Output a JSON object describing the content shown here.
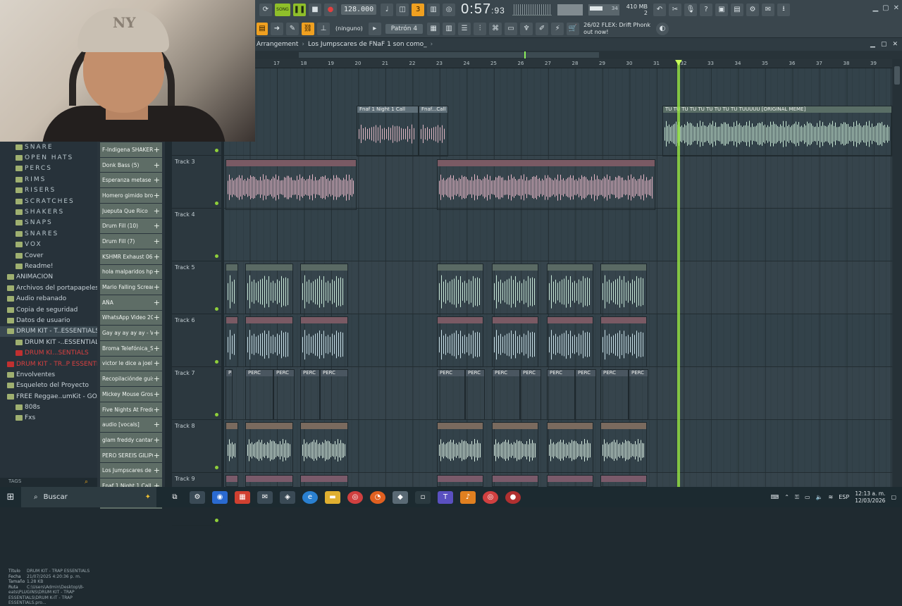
{
  "toolbar": {
    "song_label": "SONG",
    "tempo": "128.000",
    "time": "0:57",
    "time_frac": "93",
    "time_unit": "M:S:CS",
    "cpu_value": "34",
    "mem_value": "410 MB",
    "mem_poly": "2",
    "snap_value": "(ninguno)",
    "pattern": "Patrón 4",
    "hint_line1": "26/02  FLEX: Drift Phonk",
    "hint_line2": "out now!"
  },
  "arrangement": {
    "label": "Arrangement",
    "project": "Los Jumpscares de FNaF 1 son como_"
  },
  "ruler": [
    "17",
    "18",
    "19",
    "20",
    "21",
    "22",
    "23",
    "24",
    "25",
    "26",
    "27",
    "28",
    "29",
    "30",
    "31",
    "32",
    "33",
    "34",
    "35",
    "36",
    "37",
    "38",
    "39"
  ],
  "browser": {
    "items": [
      {
        "label": "SNARE",
        "style": "caps"
      },
      {
        "label": "OPEN HATS",
        "style": "caps"
      },
      {
        "label": "PERCS",
        "style": "caps"
      },
      {
        "label": "RIMS",
        "style": "caps"
      },
      {
        "label": "RISERS",
        "style": "caps"
      },
      {
        "label": "SCRATCHES",
        "style": "caps"
      },
      {
        "label": "SHAKERS",
        "style": "caps"
      },
      {
        "label": "SNAPS",
        "style": "caps"
      },
      {
        "label": "SNARES",
        "style": "caps"
      },
      {
        "label": "VOX",
        "style": "caps"
      },
      {
        "label": "Cover",
        "style": ""
      },
      {
        "label": "Readme!",
        "style": ""
      },
      {
        "label": "ANIMACION",
        "style": ""
      },
      {
        "label": "Archivos del portapapeles",
        "style": ""
      },
      {
        "label": "Audio rebanado",
        "style": ""
      },
      {
        "label": "Copia de seguridad",
        "style": ""
      },
      {
        "label": "Datos de usuario",
        "style": ""
      },
      {
        "label": "DRUM KIT - T..ESSENTIALS",
        "style": "sel"
      },
      {
        "label": "DRUM KIT -..ESSENTIALS",
        "style": ""
      },
      {
        "label": "DRUM KI...SENTIALS",
        "style": "red"
      },
      {
        "label": "DRUM KIT - TR..P ESSENTIALS",
        "style": "red"
      },
      {
        "label": "Envolventes",
        "style": ""
      },
      {
        "label": "Esqueleto del Proyecto",
        "style": ""
      },
      {
        "label": "FREE Reggae..umKit - GOAT",
        "style": ""
      },
      {
        "label": "808s",
        "style": ""
      },
      {
        "label": "Fxs",
        "style": ""
      }
    ],
    "info": {
      "titulo_k": "Título",
      "titulo_v": "DRUM KIT - TRAP ESSENTIALS",
      "fecha_k": "Fecha",
      "fecha_v": "21/07/2025 4:20:36 p. m.",
      "tamano_k": "Tamaño",
      "tamano_v": "1.28 KB",
      "ruta_k": "Ruta",
      "ruta_v": "C:\\Users\\Admin\\Desktop\\B-eats\\PLUGINS\\DRUM KIT - TRAP ESSENTIALS\\DRUM K-IT - TRAP ESSENTIALS.pro..."
    },
    "tags_label": "TAGS"
  },
  "channels": [
    "F-Indigena SHAKER_3",
    "Donk Bass (5)",
    "Esperanza metase él...",
    "Homero gimido bro...",
    "Jueputa Que Rico",
    "Drum Fill (10)",
    "Drum Fill (7)",
    "KSHMR Exhaust 06",
    "hola  malparidos  hpt",
    "Mario Falling Scream...",
    "AÑA",
    "WhatsApp Video 2025...",
    "Gay ay ay ay ay - Voi...",
    "Broma Telefónica_S...",
    "victor le dice a joel (J...",
    "Recopilaciónde guisas",
    "Mickey Mouse Groser...",
    "Five Nights At Freddy...",
    "audio [vocals]",
    "glam freddy cantand...",
    "PERO SEREIS GILIPOL...",
    "Los Jumpscares de F...",
    "Fnaf 1 Night 1 Call",
    "TU TU TU TU TU TU TU..."
  ],
  "tracks": [
    "",
    "Track 3",
    "Track 4",
    "Track 5",
    "Track 6",
    "Track 7",
    "Track 8",
    "Track 9"
  ],
  "clips": {
    "fnaf_a": "Fnaf 1 Night 1 Call",
    "fnaf_b": "Fnaf...Call",
    "tutu": "TU TU TU TU TU TU TU TU TU TUUUUU [ORIGINAL MEME]",
    "perc": "PERC"
  },
  "taskbar": {
    "search": "Buscar",
    "lang": "ESP",
    "time": "12:13 a. m.",
    "date": "12/03/2026"
  },
  "colors": {
    "accent": "#8fbf2a",
    "clip_pink": "#d8a8b4",
    "clip_mint": "#b8d8c8",
    "clip_rose": "#8a6a6a",
    "playhead": "#9cf040"
  }
}
